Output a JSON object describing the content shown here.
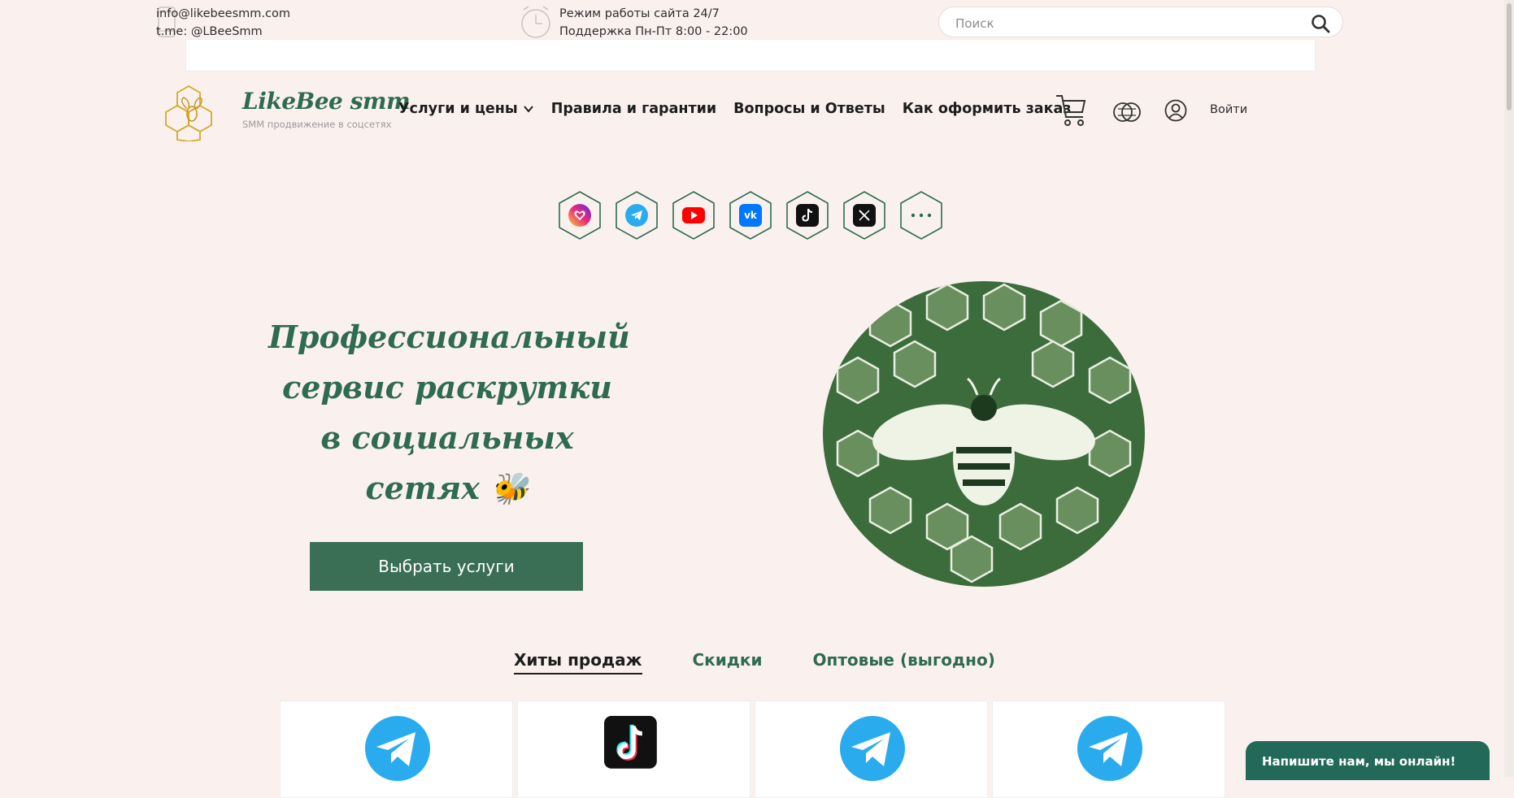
{
  "topbar": {
    "email": "info@likebeesmm.com",
    "telegram": "t.me: @LBeeSmm",
    "hours_line1": "Режим работы сайта 24/7",
    "hours_line2": "Поддержка Пн-Пт 8:00 - 22:00",
    "search_placeholder": "Поиск",
    "search_value": ""
  },
  "header": {
    "brand": "LikeBee smm",
    "tagline": "SMM продвижение в соцсетях",
    "nav": [
      {
        "label": "Услуги и цены",
        "icon": "chevron-down-icon"
      },
      {
        "label": "Правила и гарантии"
      },
      {
        "label": "Вопросы и Ответы"
      },
      {
        "label": "Как оформить заказ"
      }
    ],
    "login_label": "Войти"
  },
  "social": [
    {
      "name": "instagram",
      "color": "#e1306c"
    },
    {
      "name": "telegram",
      "color": "#2aabee"
    },
    {
      "name": "youtube",
      "color": "#ff0000"
    },
    {
      "name": "vk",
      "color": "#0077ff"
    },
    {
      "name": "tiktok",
      "color": "#111111"
    },
    {
      "name": "x-twitter",
      "color": "#111111"
    },
    {
      "name": "more",
      "color": "#2e6b4f"
    }
  ],
  "hero": {
    "line1": "Профессиональный",
    "line2": "сервис раскрутки",
    "line3": "в социальных",
    "line4": "сетях 🐝",
    "cta_label": "Выбрать услуги"
  },
  "tabs": [
    {
      "label": "Хиты продаж",
      "active": true
    },
    {
      "label": "Скидки",
      "active": false
    },
    {
      "label": "Оптовые (выгодно)",
      "active": false
    }
  ],
  "cards": [
    {
      "icon": "telegram-icon"
    },
    {
      "icon": "tiktok-icon"
    },
    {
      "icon": "telegram-icon"
    },
    {
      "icon": "telegram-icon"
    }
  ],
  "chat": {
    "label": "Напишите нам, мы онлайн!"
  },
  "colors": {
    "accent": "#2e6b4f",
    "button": "#3a6e55",
    "background": "#faf1ee",
    "chat": "#22695a"
  }
}
